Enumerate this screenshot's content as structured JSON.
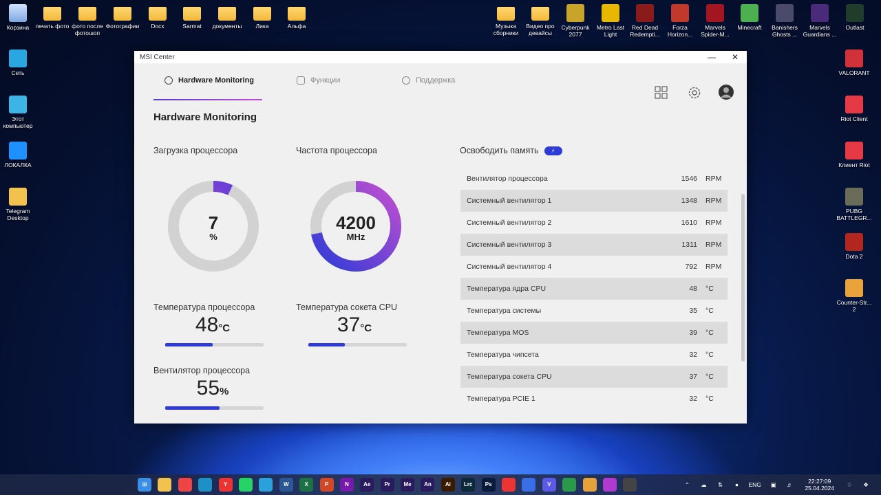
{
  "desktop_left": [
    {
      "label": "Корзина",
      "kind": "bin"
    },
    {
      "label": "печать фото",
      "kind": "folder"
    },
    {
      "label": "фото после фотошоп",
      "kind": "folder"
    },
    {
      "label": "Фотографии",
      "kind": "folder"
    },
    {
      "label": "Docx",
      "kind": "folder"
    },
    {
      "label": "Sarmat",
      "kind": "folder"
    },
    {
      "label": "документы",
      "kind": "folder"
    },
    {
      "label": "Лика",
      "kind": "folder"
    },
    {
      "label": "Альфа",
      "kind": "folder"
    }
  ],
  "desktop_left_col": [
    {
      "label": "Сеть"
    },
    {
      "label": "Этот компьютер"
    },
    {
      "label": "ЛОКАЛКА"
    },
    {
      "label": "Telegram Desktop"
    }
  ],
  "desktop_right": [
    {
      "label": "Музыка сборники"
    },
    {
      "label": "Видео про девайсы"
    },
    {
      "label": "Cyberpunk 2077"
    },
    {
      "label": "Metro Last Light"
    },
    {
      "label": "Red Dead Redempti..."
    },
    {
      "label": "Forza Horizon..."
    },
    {
      "label": "Marvels Spider-M..."
    },
    {
      "label": "Minecraft"
    },
    {
      "label": "Banishers Ghosts ..."
    },
    {
      "label": "Marvels Guardians ..."
    },
    {
      "label": "Outlast"
    }
  ],
  "desktop_right_col": [
    {
      "label": "VALORANT"
    },
    {
      "label": "Riot Client"
    },
    {
      "label": "Клиент Riot"
    },
    {
      "label": "PUBG BATTLEGR..."
    },
    {
      "label": "Dota 2"
    },
    {
      "label": "Counter-Str... 2"
    }
  ],
  "window": {
    "title": "MSI Center",
    "tabs": {
      "hardware": "Hardware Monitoring",
      "features": "Функции",
      "support": "Поддержка"
    },
    "page_title": "Hardware Monitoring",
    "cpu_load": {
      "label": "Загрузка процессора",
      "value": "7",
      "unit": "%",
      "fraction": 0.07
    },
    "cpu_freq": {
      "label": "Частота процессора",
      "value": "4200",
      "unit": "MHz",
      "fraction": 0.72
    },
    "cpu_temp": {
      "label": "Температура процессора",
      "value": "48",
      "unit": "°C",
      "fraction": 0.48
    },
    "socket_temp": {
      "label": "Температура сокета CPU",
      "value": "37",
      "unit": "°C",
      "fraction": 0.37
    },
    "cpu_fan": {
      "label": "Вентилятор процессора",
      "value": "55",
      "unit": "%",
      "fraction": 0.55
    },
    "free_memory": "Освободить память",
    "sensors": [
      {
        "name": "Вентилятор процессора",
        "value": "1546",
        "unit": "RPM"
      },
      {
        "name": "Системный вентилятор 1",
        "value": "1348",
        "unit": "RPM"
      },
      {
        "name": "Системный вентилятор 2",
        "value": "1610",
        "unit": "RPM"
      },
      {
        "name": "Системный вентилятор 3",
        "value": "1311",
        "unit": "RPM"
      },
      {
        "name": "Системный вентилятор 4",
        "value": "792",
        "unit": "RPM"
      },
      {
        "name": "Температура ядра CPU",
        "value": "48",
        "unit": "°C"
      },
      {
        "name": "Температура системы",
        "value": "35",
        "unit": "°C"
      },
      {
        "name": "Температура MOS",
        "value": "39",
        "unit": "°C"
      },
      {
        "name": "Температура чипсета",
        "value": "32",
        "unit": "°C"
      },
      {
        "name": "Температура сокета CPU",
        "value": "37",
        "unit": "°C"
      },
      {
        "name": "Температура PCIE 1",
        "value": "32",
        "unit": "°C"
      }
    ]
  },
  "taskbar": {
    "lang": "ENG",
    "time": "22:27:09",
    "date": "25.04.2024"
  },
  "colors": {
    "accent": "#2e3bd6",
    "accent2": "#c14fd1"
  }
}
